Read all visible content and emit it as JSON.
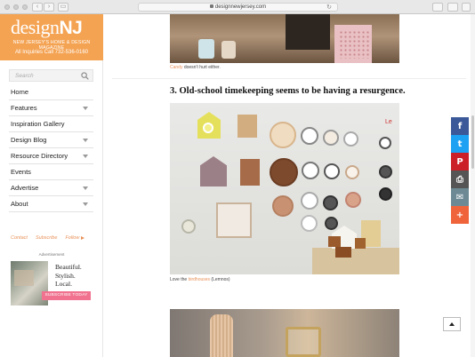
{
  "browser": {
    "url": "designnewjersey.com"
  },
  "sidebar": {
    "logo_text": "design",
    "logo_nj": "NJ",
    "tagline": "NEW JERSEY'S HOME & DESIGN MAGAZINE",
    "inquiries": "All Inquiries Call 732-536-0160",
    "search_placeholder": "Search",
    "menu": [
      {
        "label": "Home",
        "has_caret": false
      },
      {
        "label": "Features",
        "has_caret": true
      },
      {
        "label": "Inspiration Gallery",
        "has_caret": false
      },
      {
        "label": "Design Blog",
        "has_caret": true
      },
      {
        "label": "Resource Directory",
        "has_caret": true
      },
      {
        "label": "Events",
        "has_caret": false
      },
      {
        "label": "Advertise",
        "has_caret": true
      },
      {
        "label": "About",
        "has_caret": true
      }
    ],
    "footer_links": [
      "Contact",
      "Subscribe",
      "Follow"
    ],
    "ad_label": "Advertisement",
    "ad": {
      "line1": "Beautiful.",
      "line2": "Stylish.",
      "line3": "Local.",
      "button": "SUBSCRIBE TODAY"
    }
  },
  "article": {
    "caption_top": {
      "link": "Candy",
      "text": " doesn't hurt either."
    },
    "heading": "3. Old-school timekeeping seems to be having a resurgence.",
    "caption_main": {
      "before": "Love the ",
      "link": "birdhouses",
      "after": " (Lemnos)"
    },
    "photo_sign": "Le"
  },
  "share": [
    {
      "name": "facebook",
      "glyph": "f",
      "color": "#3b5998"
    },
    {
      "name": "twitter",
      "glyph": "t",
      "color": "#1da1f2"
    },
    {
      "name": "pinterest",
      "glyph": "P",
      "color": "#cb2027"
    },
    {
      "name": "print",
      "glyph": "⎙",
      "color": "#555555"
    },
    {
      "name": "email",
      "glyph": "✉",
      "color": "#6d8a94"
    },
    {
      "name": "more",
      "glyph": "+",
      "color": "#f0643c"
    }
  ]
}
